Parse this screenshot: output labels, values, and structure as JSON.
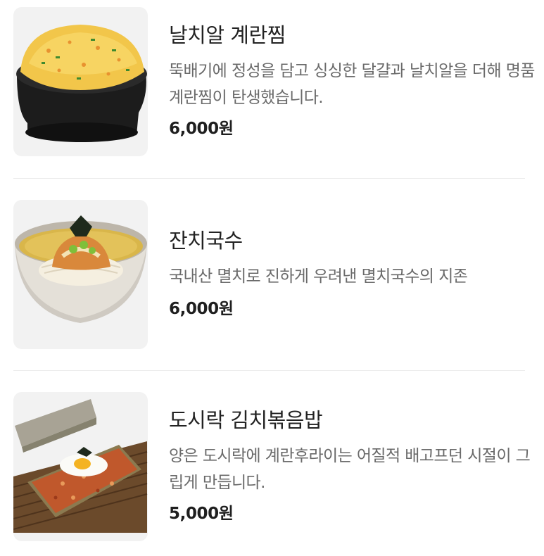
{
  "menu": {
    "items": [
      {
        "name": "날치알 계란찜",
        "description": "뚝배기에 정성을 담고 싱싱한 달걀과 날치알을 더해 명품 계란찜이 탄생했습니다.",
        "price": "6,000원",
        "image_icon": "steamed-egg-icon"
      },
      {
        "name": "잔치국수",
        "description": "국내산 멸치로 진하게 우려낸 멸치국수의 지존",
        "price": "6,000원",
        "image_icon": "noodle-soup-icon"
      },
      {
        "name": "도시락 김치볶음밥",
        "description": "양은 도시락에 계란후라이는 어질적 배고프던 시절이 그립게 만듭니다.",
        "price": "5,000원",
        "image_icon": "kimchi-fried-rice-icon"
      }
    ]
  },
  "colors": {
    "thumb_background": "#f2f2f2",
    "divider": "#ececec",
    "description_text": "#6a6a6a",
    "title_text": "#222222"
  }
}
